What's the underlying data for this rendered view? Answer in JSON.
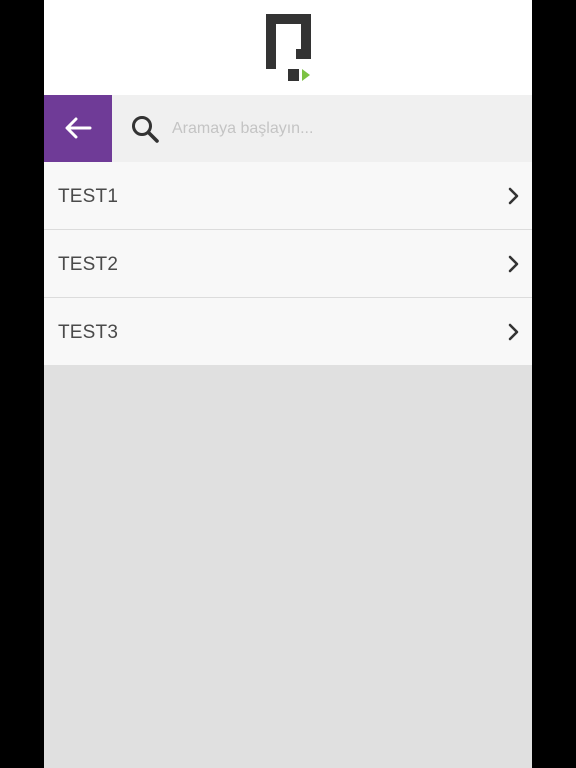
{
  "header": {
    "logo_icon": "brand-logo-icon",
    "colors": {
      "logo_dark": "#333333",
      "logo_accent": "#7dc243"
    }
  },
  "search": {
    "back_icon": "arrow-left-icon",
    "search_icon": "search-icon",
    "placeholder": "Aramaya başlayın...",
    "value": ""
  },
  "list": {
    "items": [
      {
        "label": "TEST1",
        "icon": "chevron-right-icon"
      },
      {
        "label": "TEST2",
        "icon": "chevron-right-icon"
      },
      {
        "label": "TEST3",
        "icon": "chevron-right-icon"
      }
    ]
  },
  "colors": {
    "accent": "#6f3b97",
    "row_background": "#f8f8f8",
    "search_background": "#f0f0f0",
    "content_background": "#e0e0e0"
  }
}
